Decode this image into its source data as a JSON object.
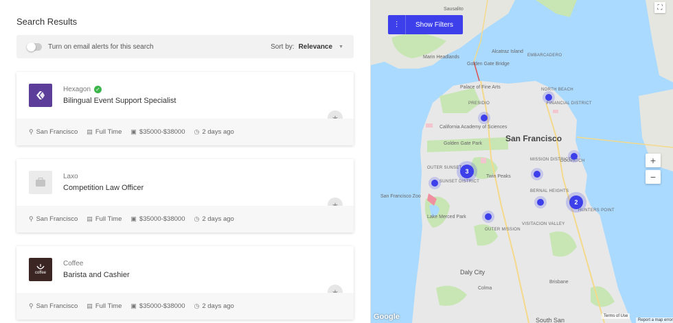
{
  "page_title": "Search Results",
  "alerts": {
    "label": "Turn on email alerts for this search",
    "enabled": false
  },
  "sort": {
    "label": "Sort by:",
    "value": "Relevance"
  },
  "jobs": [
    {
      "company": "Hexagon",
      "verified": true,
      "title": "Bilingual Event Support Specialist",
      "location": "San Francisco",
      "type": "Full Time",
      "salary": "$35000-$38000",
      "posted": "2 days ago",
      "logo_icon": "hexagon-logo"
    },
    {
      "company": "Laxo",
      "verified": false,
      "title": "Competition Law Officer",
      "location": "San Francisco",
      "type": "Full Time",
      "salary": "$35000-$38000",
      "posted": "2 days ago",
      "logo_icon": "briefcase-icon"
    },
    {
      "company": "Coffee",
      "verified": false,
      "title": "Barista and Cashier",
      "location": "San Francisco",
      "type": "Full Time",
      "salary": "$35000-$38000",
      "posted": "2 days ago",
      "logo_icon": "coffee-logo",
      "logo_text": "coffee"
    }
  ],
  "map": {
    "show_filters_label": "Show Filters",
    "city_label": "San Francisco",
    "labels": {
      "sausalito": "Sausalito",
      "alcatraz": "Alcatraz Island",
      "embarcadero": "EMBARCADERO",
      "marin_headlands": "Marin\nHeadlands",
      "golden_gate_bridge": "Golden Gate Bridge",
      "palace": "Palace of Fine Arts",
      "presidio": "PRESIDIO",
      "north_beach": "NORTH BEACH",
      "financial": "FINANCIAL DISTRICT",
      "academy": "California Academy of Sciences",
      "gg_park": "Golden Gate Park",
      "outer_sunset": "OUTER SUNSET",
      "sunset_district": "SUNSET DISTRICT",
      "twin_peaks": "Twin Peaks",
      "mission": "MISSION DISTRICT",
      "dogpatch": "DOGPATCH",
      "bernal": "BERNAL HEIGHTS",
      "zoo": "San Francisco Zoo",
      "hunters": "HUNTERS POINT",
      "lake_merced": "Lake Merced Park",
      "outer_mission": "OUTER MISSION",
      "visitacion": "VISITACION VALLEY",
      "daly_city": "Daly City",
      "colma": "Colma",
      "brisbane": "Brisbane",
      "south_san": "South San"
    },
    "clusters": [
      {
        "count": "3"
      },
      {
        "count": "2"
      }
    ],
    "zoom_in": "+",
    "zoom_out": "−",
    "attribution_google": "Google",
    "terms": "Terms of Use",
    "report": "Report a map error"
  },
  "colors": {
    "accent": "#3d40ea",
    "water": "#aadaff",
    "land": "#e8e8e8",
    "park": "#c8e6b4",
    "verified": "#3cb54a"
  }
}
